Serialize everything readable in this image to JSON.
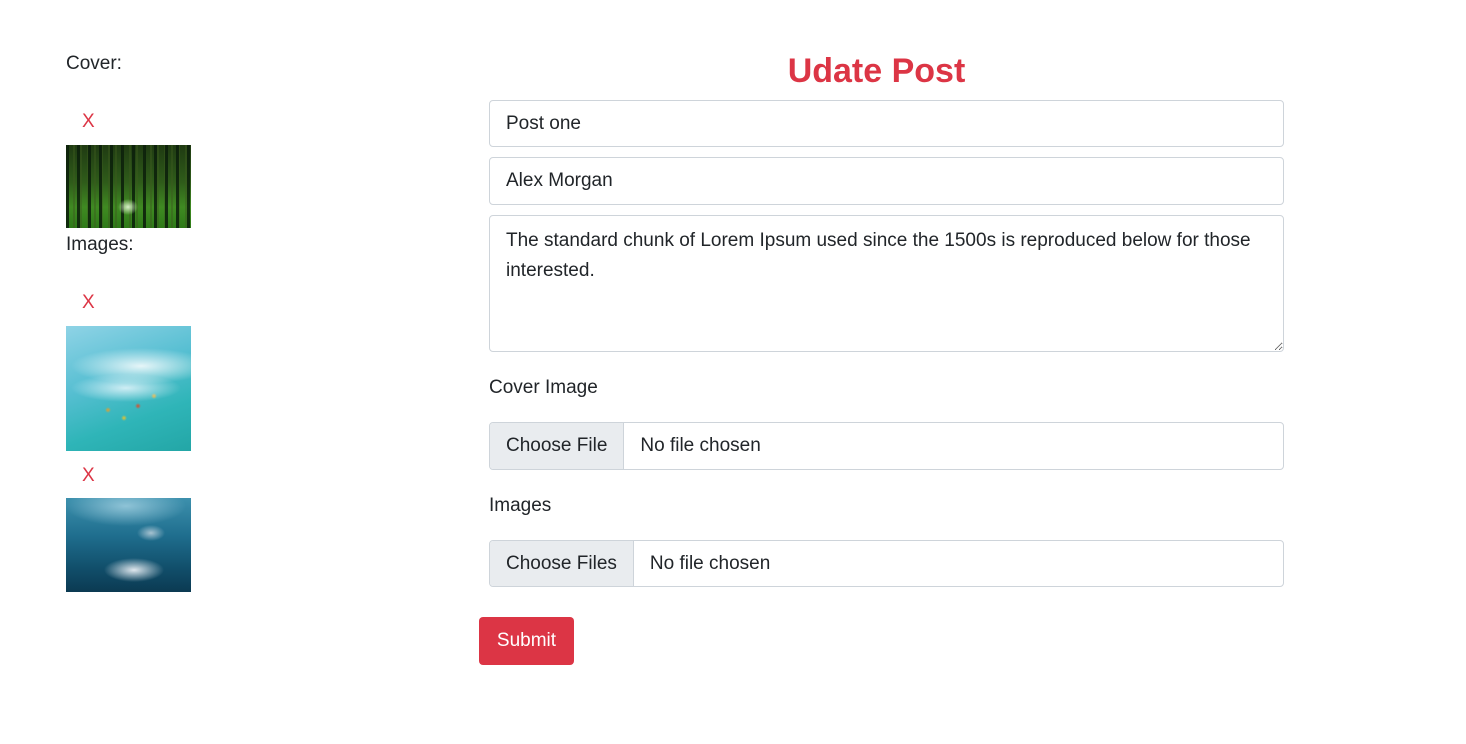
{
  "left": {
    "cover_label": "Cover:",
    "images_label": "Images:",
    "remove_label": "X"
  },
  "form": {
    "title": "Udate Post",
    "title_value": "Post one",
    "author_value": "Alex Morgan",
    "body_value": "The standard chunk of Lorem Ipsum used since the 1500s is reproduced below for those interested.",
    "cover_label": "Cover Image",
    "cover_button": "Choose File",
    "cover_status": "No file chosen",
    "images_label": "Images",
    "images_button": "Choose Files",
    "images_status": "No file chosen",
    "submit_label": "Submit"
  },
  "colors": {
    "accent": "#dc3545",
    "text": "#212529",
    "border": "#ced4da",
    "file_button_bg": "#e9ecef"
  }
}
